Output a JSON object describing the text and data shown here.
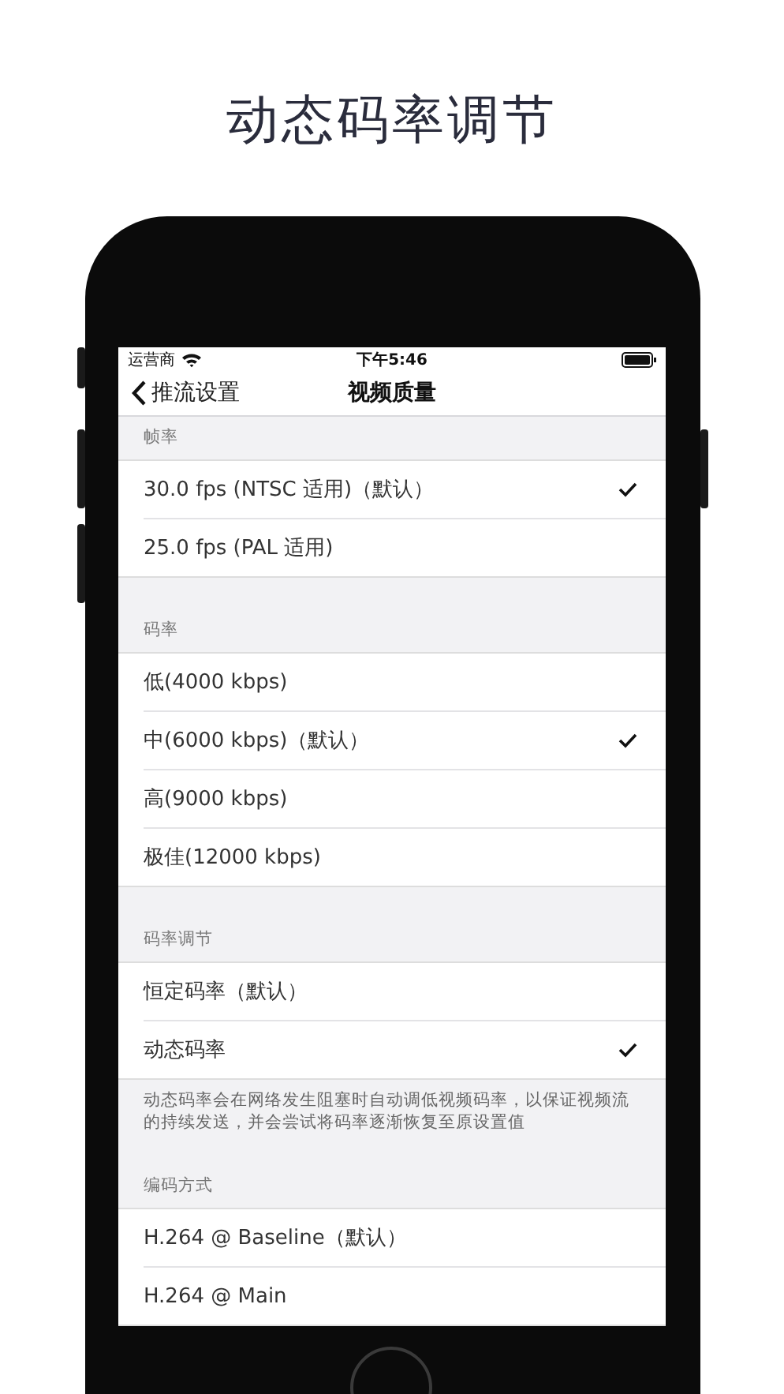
{
  "headline": "动态码率调节",
  "status_bar": {
    "carrier": "运营商",
    "time": "下午5:46"
  },
  "nav": {
    "back": "推流设置",
    "title": "视频质量"
  },
  "sections": [
    {
      "header": "帧率",
      "items": [
        {
          "label": "30.0 fps (NTSC 适用)（默认）",
          "selected": true
        },
        {
          "label": "25.0 fps (PAL 适用)",
          "selected": false
        }
      ]
    },
    {
      "header": "码率",
      "items": [
        {
          "label": "低(4000 kbps)",
          "selected": false
        },
        {
          "label": "中(6000 kbps)（默认）",
          "selected": true
        },
        {
          "label": "高(9000 kbps)",
          "selected": false
        },
        {
          "label": "极佳(12000 kbps)",
          "selected": false
        }
      ]
    },
    {
      "header": "码率调节",
      "items": [
        {
          "label": "恒定码率（默认）",
          "selected": false
        },
        {
          "label": "动态码率",
          "selected": true
        }
      ],
      "footer": "动态码率会在网络发生阻塞时自动调低视频码率，以保证视频流的持续发送，并会尝试将码率逐渐恢复至原设置值"
    },
    {
      "header": "编码方式",
      "items": [
        {
          "label": "H.264 @ Baseline（默认）",
          "selected": false
        },
        {
          "label": "H.264 @ Main",
          "selected": false
        }
      ]
    }
  ]
}
